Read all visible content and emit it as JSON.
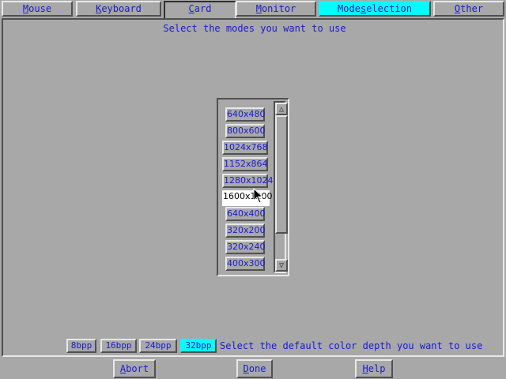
{
  "tabs": [
    {
      "first": "M",
      "rest": "ouse",
      "active": false
    },
    {
      "first": "K",
      "rest": "eyboard",
      "active": false
    },
    {
      "first": "C",
      "rest": "ard",
      "active": false
    },
    {
      "pre": "",
      "first": "M",
      "rest": "onitor",
      "active": false
    },
    {
      "pre": "Mode",
      "first": "s",
      "rest": "election",
      "active": true
    },
    {
      "first": "O",
      "rest": "ther",
      "active": false
    }
  ],
  "instruction": "Select the modes you want to use",
  "modes": [
    "640x480",
    "800x600",
    "1024x768",
    "1152x864",
    "1280x1024",
    "1600x1200",
    "640x400",
    "320x200",
    "320x240",
    "400x300"
  ],
  "selected_mode": "1600x1200",
  "scroll": {
    "up_icon": "triangle-up",
    "down_icon": "triangle-down"
  },
  "depths": [
    "8bpp",
    "16bpp",
    "24bpp",
    "32bpp"
  ],
  "active_depth": "32bpp",
  "depth_label": "Select the default color depth you want to use",
  "buttons": {
    "abort": {
      "first": "A",
      "rest": "bort"
    },
    "done": {
      "first": "D",
      "rest": "one"
    },
    "help": {
      "first": "H",
      "rest": "elp"
    }
  },
  "colors": {
    "background": "#a8a8a8",
    "accent": "#00ffff",
    "text": "#1a1ad0"
  }
}
